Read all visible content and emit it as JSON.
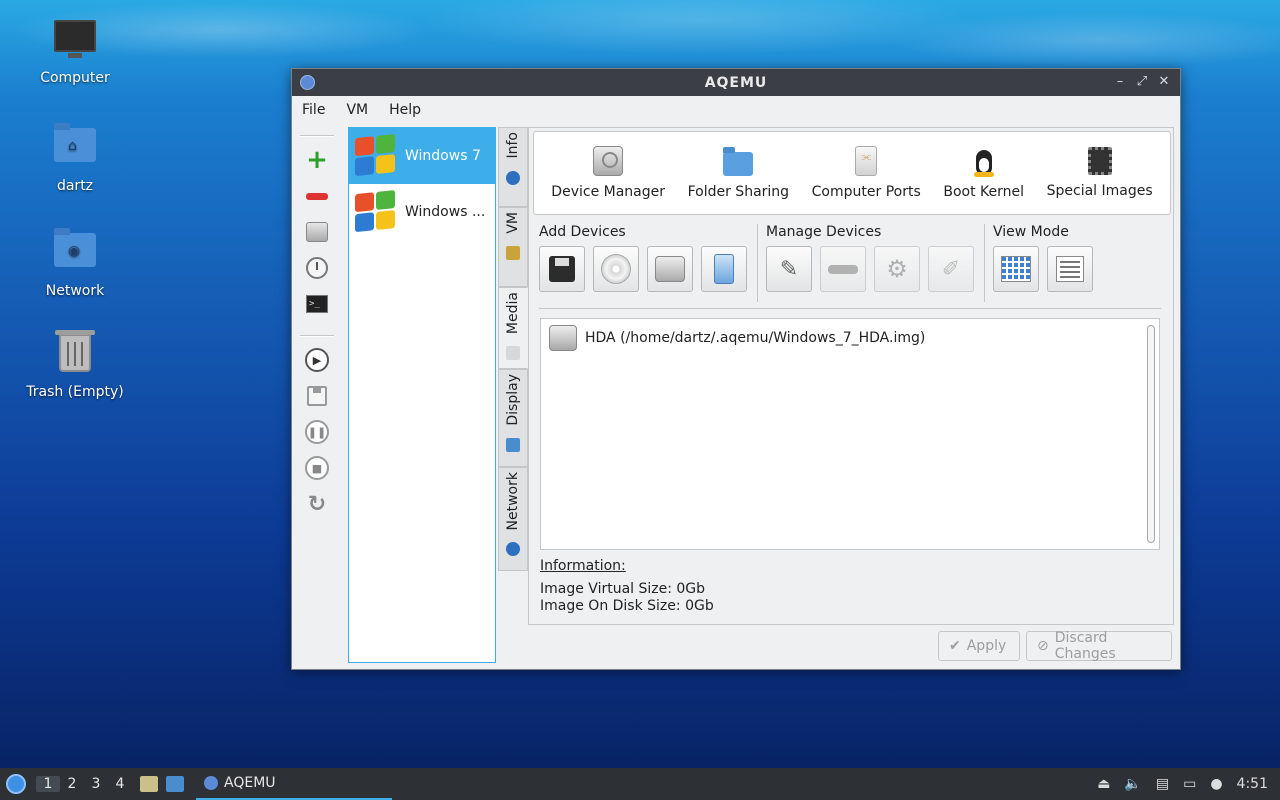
{
  "desktop": {
    "icons": [
      {
        "label": "Computer"
      },
      {
        "label": "dartz"
      },
      {
        "label": "Network"
      },
      {
        "label": "Trash (Empty)"
      }
    ]
  },
  "window": {
    "title": "AQEMU",
    "controls": {
      "minimize": "–",
      "maximize": "⤢",
      "close": "✕"
    }
  },
  "menu": {
    "file": "File",
    "vm": "VM",
    "help": "Help"
  },
  "vm_list": [
    {
      "name": "Windows 7",
      "selected": true
    },
    {
      "name": "Windows ...",
      "selected": false
    }
  ],
  "tabs": [
    {
      "label": "Info"
    },
    {
      "label": "VM"
    },
    {
      "label": "Media",
      "active": true
    },
    {
      "label": "Display"
    },
    {
      "label": "Network"
    }
  ],
  "top_toolbar": [
    {
      "label": "Device Manager",
      "icon": "hard-disk-icon"
    },
    {
      "label": "Folder Sharing",
      "icon": "folder-icon"
    },
    {
      "label": "Computer Ports",
      "icon": "usb-icon"
    },
    {
      "label": "Boot Kernel",
      "icon": "tux-icon"
    },
    {
      "label": "Special Images",
      "icon": "chip-icon"
    }
  ],
  "groups": {
    "add": "Add Devices",
    "manage": "Manage Devices",
    "view": "View Mode"
  },
  "devices": [
    {
      "label": "HDA (/home/dartz/.aqemu/Windows_7_HDA.img)"
    }
  ],
  "information": {
    "heading": "Information:",
    "virtual_size": "Image Virtual Size: 0Gb",
    "disk_size": "Image On Disk Size: 0Gb"
  },
  "buttons": {
    "apply": "Apply",
    "discard": "Discard Changes"
  },
  "taskbar": {
    "workspaces": [
      "1",
      "2",
      "3",
      "4"
    ],
    "task": "AQEMU",
    "clock": "4:51"
  }
}
